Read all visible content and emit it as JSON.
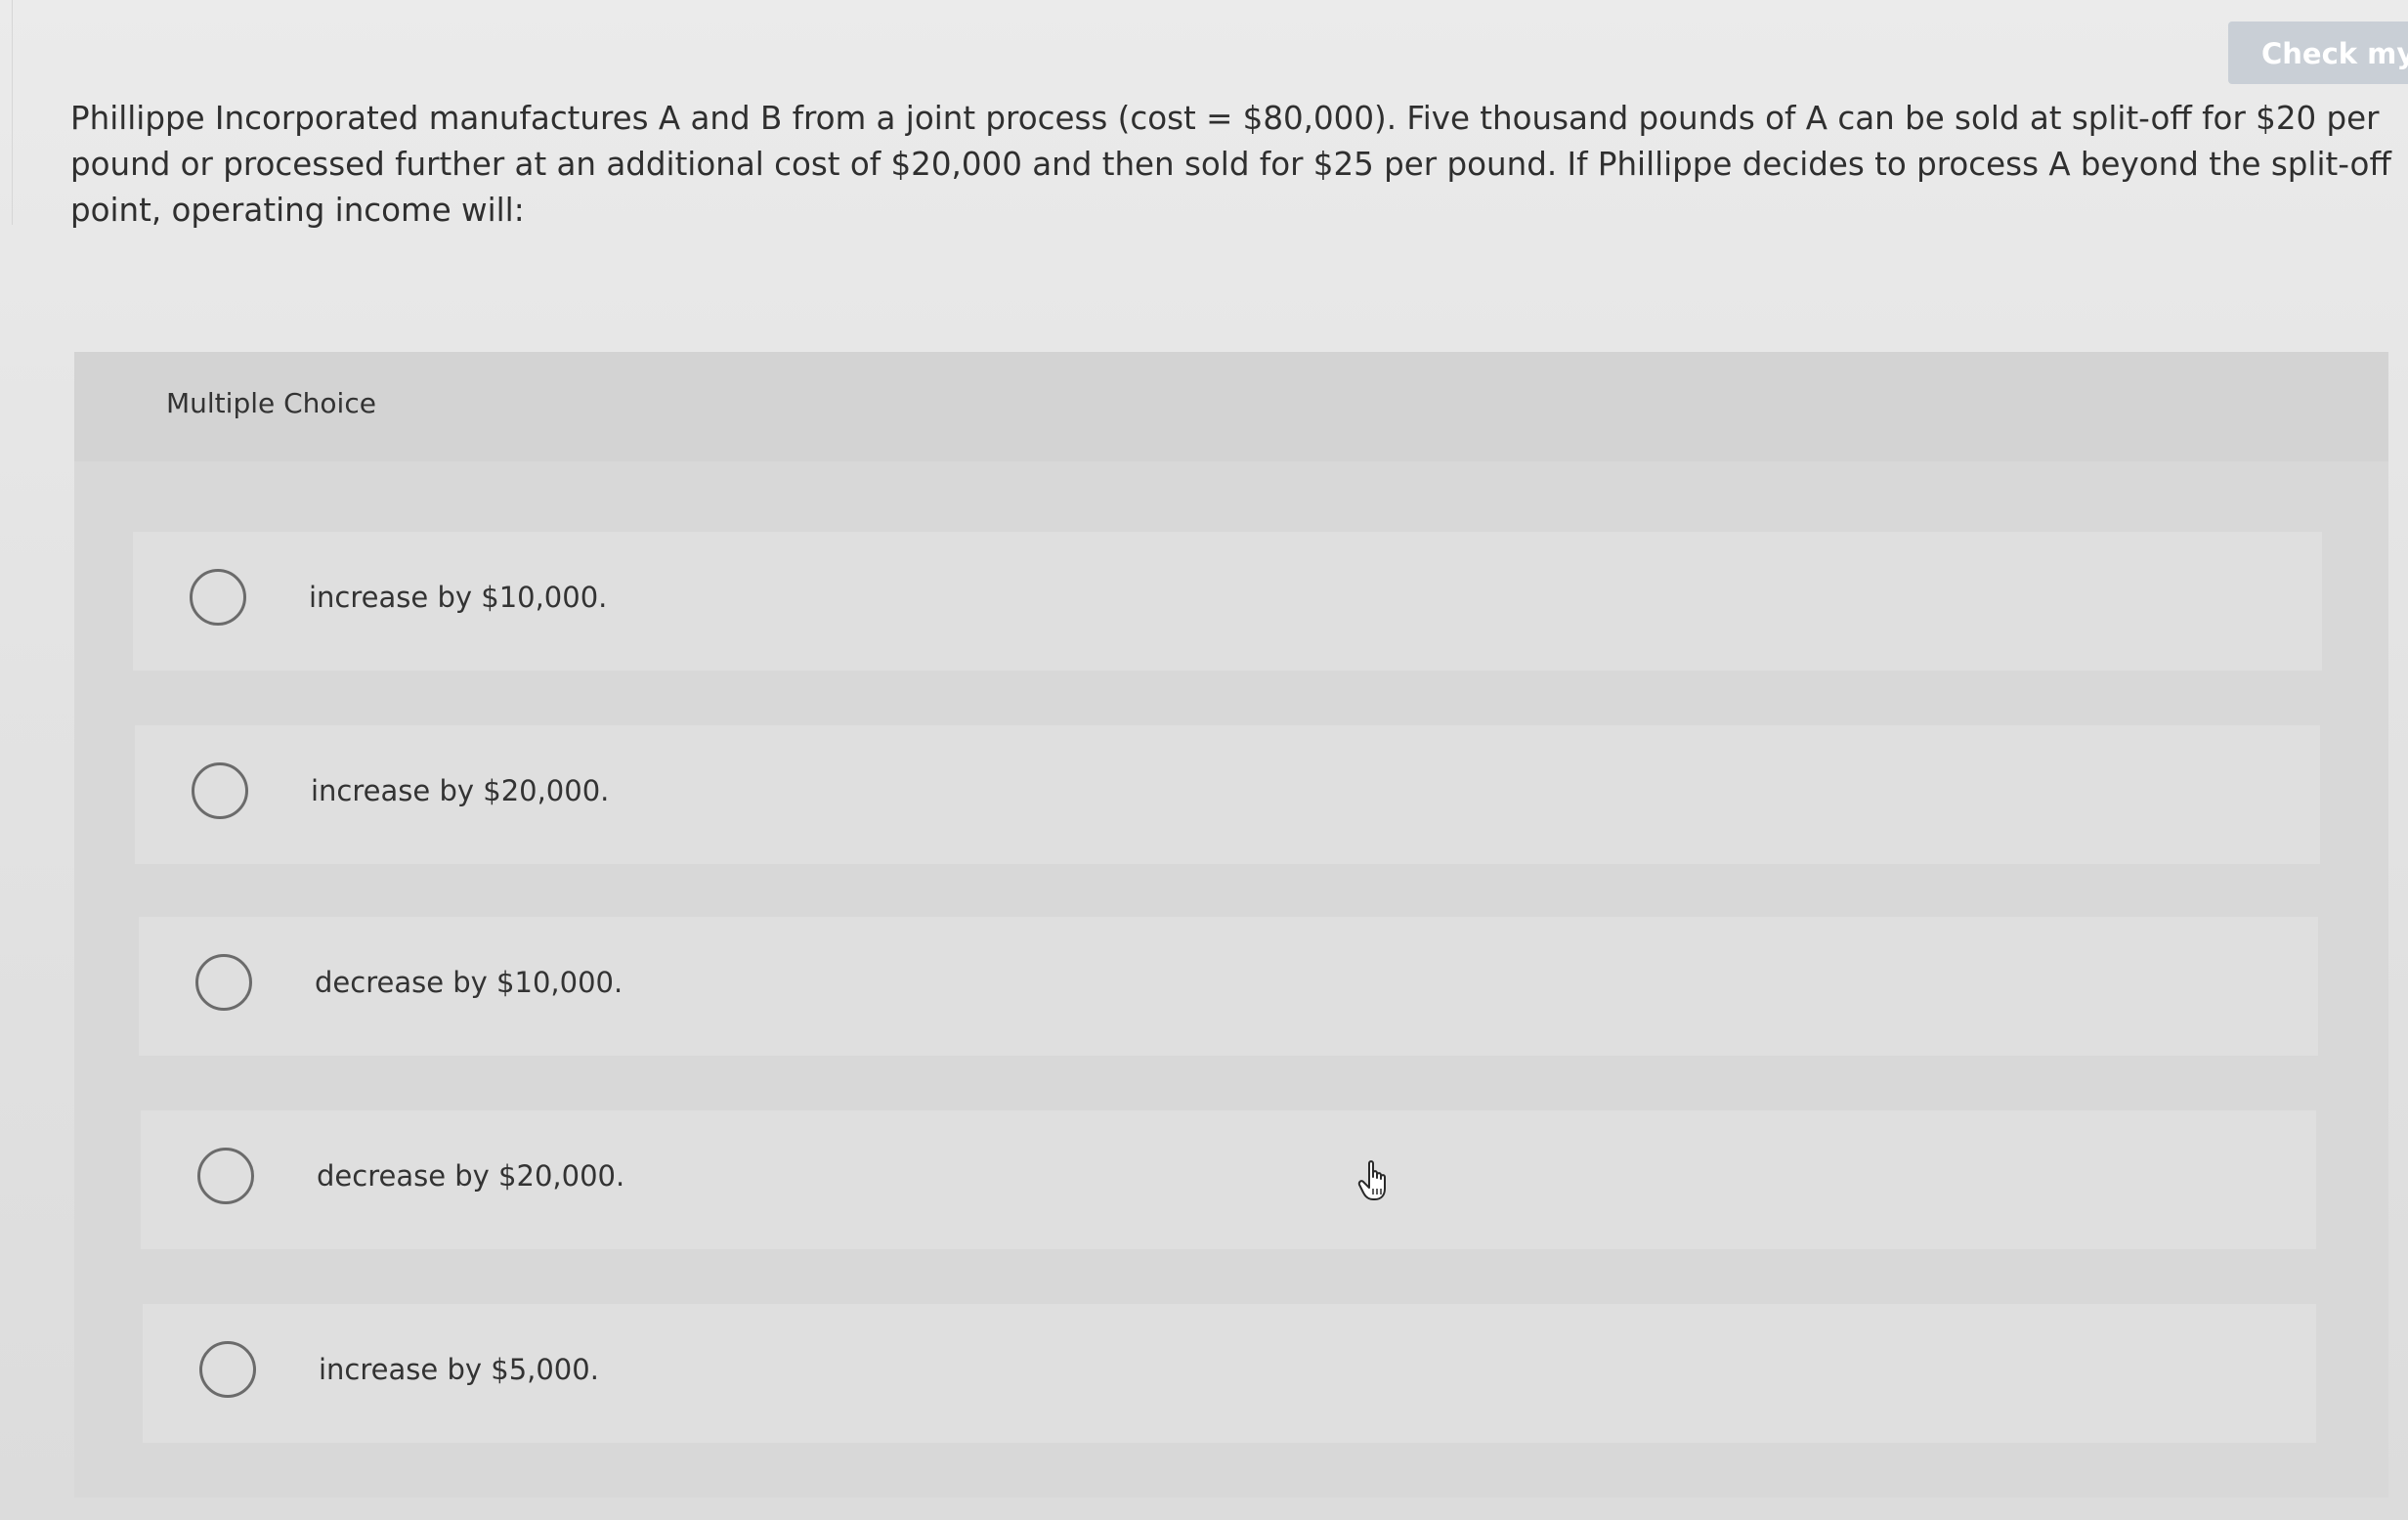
{
  "header": {
    "check_button_label": "Check my"
  },
  "question": {
    "text": "Phillippe Incorporated manufactures A and B from a joint process (cost = $80,000). Five thousand pounds of A can be sold at split-off for $20 per pound or processed further at an additional cost of $20,000 and then sold for $25 per pound. If Phillippe decides to process A beyond the split-off point, operating income will:"
  },
  "panel": {
    "title": "Multiple Choice",
    "options": [
      {
        "label": "increase by $10,000."
      },
      {
        "label": "increase by $20,000."
      },
      {
        "label": "decrease by $10,000."
      },
      {
        "label": "decrease by $20,000."
      },
      {
        "label": "increase by $5,000."
      }
    ]
  },
  "icons": {
    "cursor": "hand-pointer-icon"
  }
}
